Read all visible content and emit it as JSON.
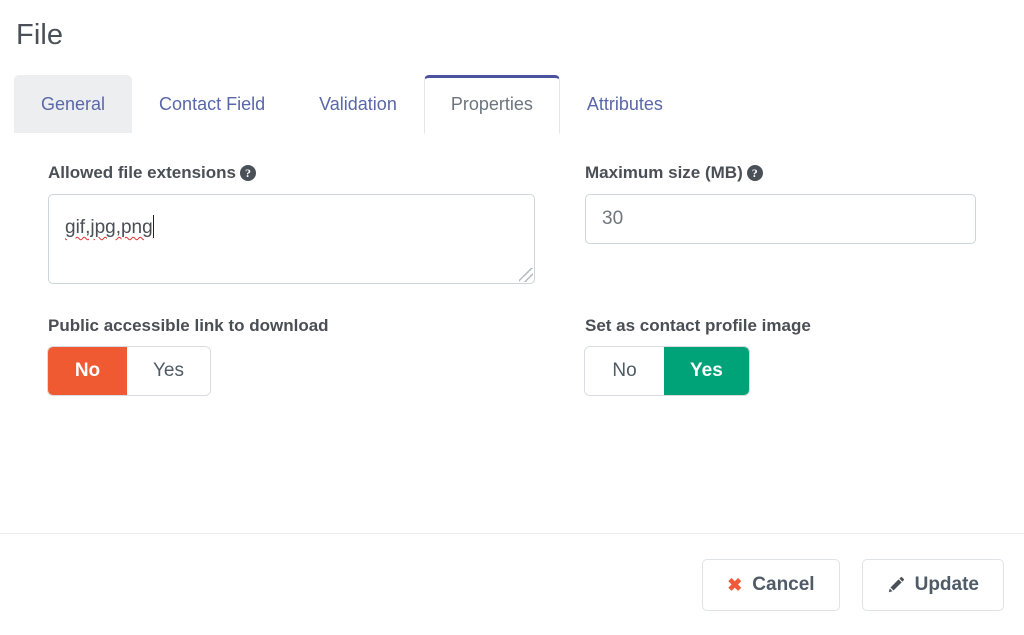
{
  "dialog": {
    "title": "File"
  },
  "tabs": {
    "items": [
      {
        "label": "General",
        "state": "hovered"
      },
      {
        "label": "Contact Field",
        "state": "inactive"
      },
      {
        "label": "Validation",
        "state": "inactive"
      },
      {
        "label": "Properties",
        "state": "active"
      },
      {
        "label": "Attributes",
        "state": "inactive"
      }
    ]
  },
  "form": {
    "allowed_extensions": {
      "label": "Allowed file extensions",
      "help_icon": "question-circle-icon",
      "value": "gif,jpg,png",
      "placeholder": ""
    },
    "maximum_size": {
      "label": "Maximum size (MB)",
      "help_icon": "question-circle-icon",
      "value": "30",
      "placeholder": "30"
    },
    "public_link": {
      "label": "Public accessible link to download",
      "options": [
        "No",
        "Yes"
      ],
      "selected": "No"
    },
    "profile_image": {
      "label": "Set as contact profile image",
      "options": [
        "No",
        "Yes"
      ],
      "selected": "Yes"
    }
  },
  "footer": {
    "cancel_label": "Cancel",
    "cancel_icon": "close-x-icon",
    "update_label": "Update",
    "update_icon": "pencil-icon"
  },
  "colors": {
    "danger": "#ef5a32",
    "success": "#00a278",
    "active_tab_border": "#4a53a0",
    "tab_link": "#5a67a8",
    "label_text": "#4a4f55"
  }
}
